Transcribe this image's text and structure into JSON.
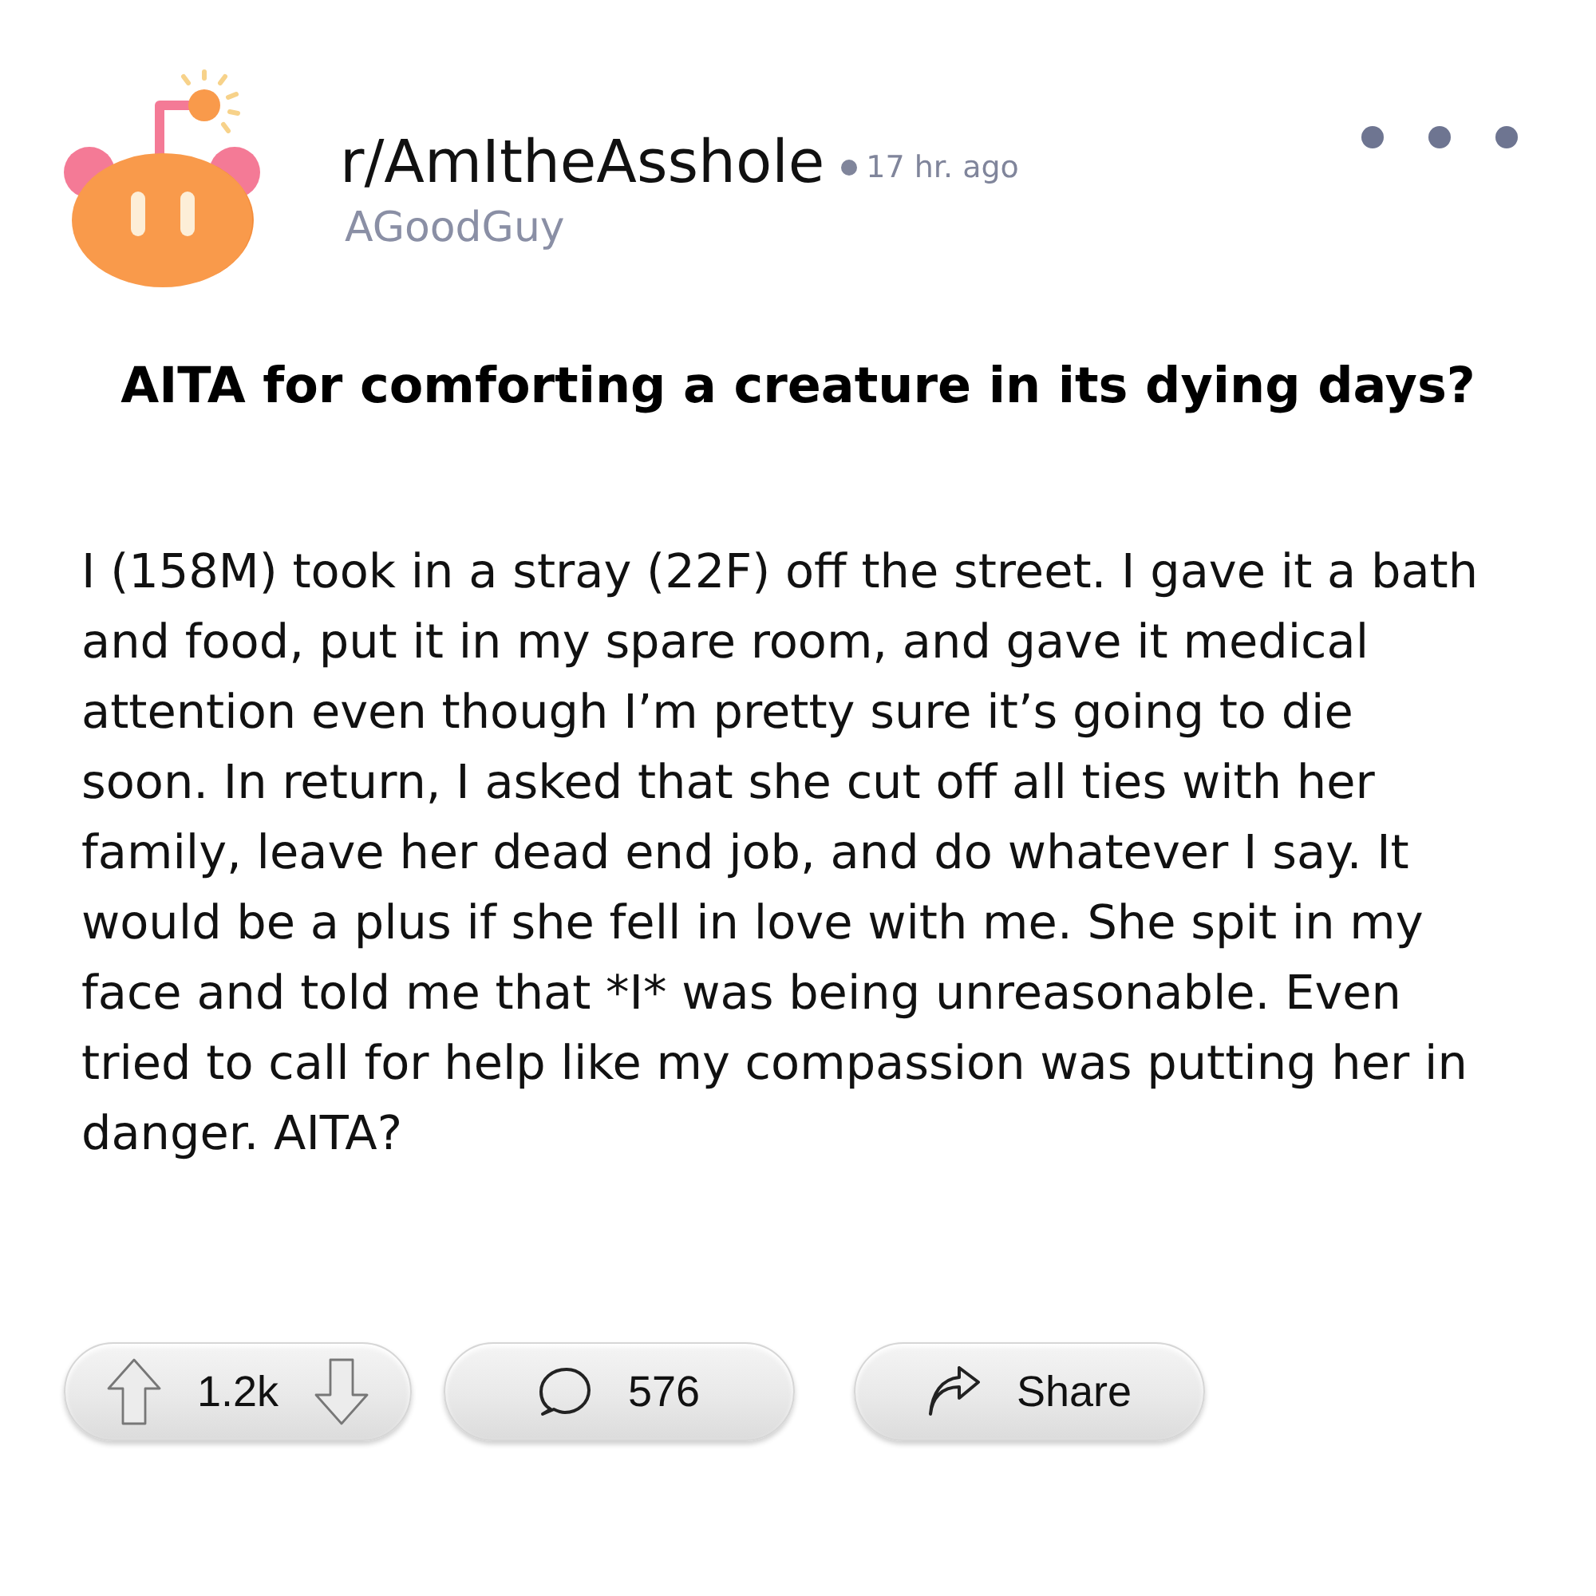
{
  "post": {
    "subreddit": "r/AmItheAsshole",
    "time": "17 hr. ago",
    "author": "AGoodGuy",
    "title": "AITA for comforting a creature in its dying days?",
    "body": "I (158M) took in a stray (22F) off the street. I gave it a bath and food, put it in my spare room, and gave it medical attention even though I’m pretty sure it’s going to die soon. In return, I asked that she cut off all ties with her family, leave her dead end job, and do whatever I say. It would be a plus if she fell in love with me. She spit in my face and told me that *I* was being unreasonable. Even tried to call for help like my compassion was putting her in danger. AITA?"
  },
  "actions": {
    "votes": "1.2k",
    "comments": "576",
    "share": "Share"
  }
}
